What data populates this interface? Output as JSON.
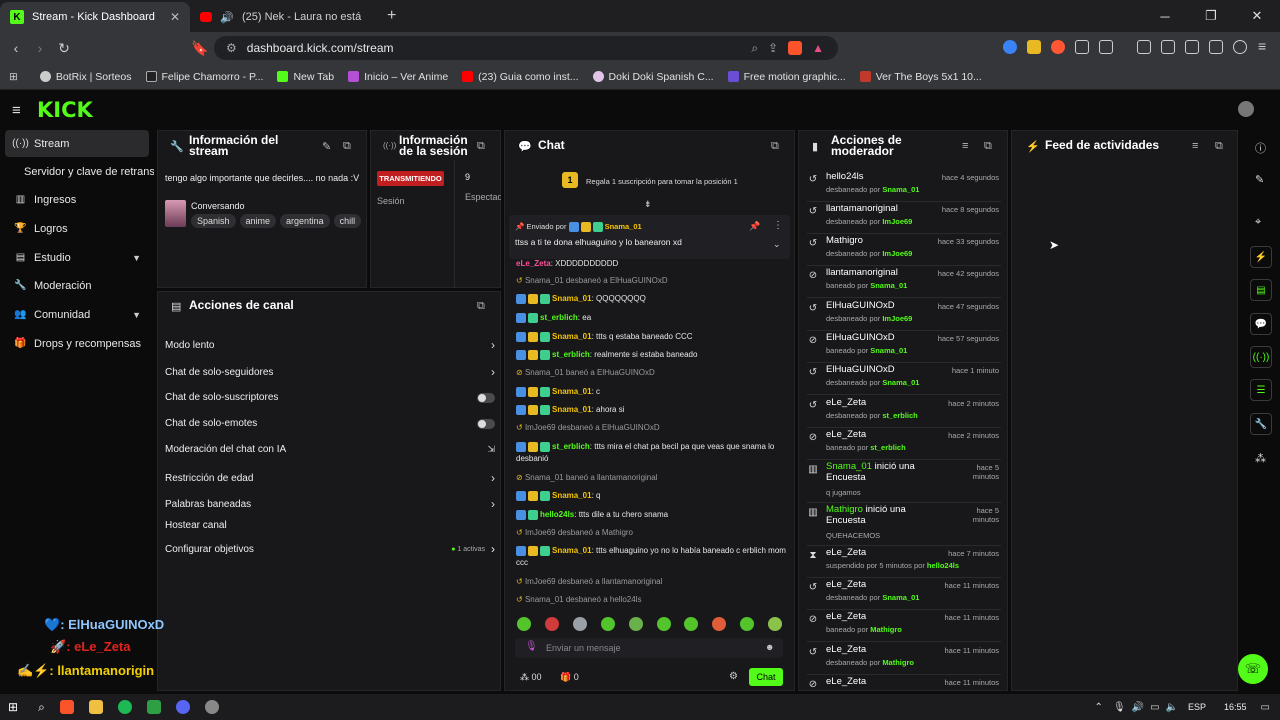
{
  "browser": {
    "tabs": [
      {
        "title": "Stream - Kick Dashboard",
        "active": true
      },
      {
        "title": "(25) Nek - Laura no está (Official ",
        "active": false
      }
    ],
    "url": "dashboard.kick.com/stream",
    "bookmarks": [
      "BotRix | Sorteos",
      "Felipe Chamorro - P...",
      "New Tab",
      "Inicio – Ver Anime",
      "(23) Guia como inst...",
      "Doki Doki Spanish C...",
      "Free motion graphic...",
      "Ver The Boys 5x1 10..."
    ]
  },
  "kick": {
    "logo": "KICK"
  },
  "sidebar": {
    "items": [
      {
        "label": "Stream",
        "icon": "broadcast-icon"
      },
      {
        "label": "Servidor y clave de retransm",
        "icon": ""
      },
      {
        "label": "Ingresos",
        "icon": "chart-icon"
      },
      {
        "label": "Logros",
        "icon": "trophy-icon"
      },
      {
        "label": "Estudio",
        "icon": "studio-icon"
      },
      {
        "label": "Moderación",
        "icon": "wrench-icon"
      },
      {
        "label": "Comunidad",
        "icon": "community-icon"
      },
      {
        "label": "Drops y recompensas",
        "icon": "gift-icon"
      }
    ]
  },
  "stream_info": {
    "title": "Información del stream",
    "description": "tengo algo importante que decirles.... no nada :V",
    "category": "Conversando",
    "tags": [
      "Spanish",
      "anime",
      "argentina",
      "chill"
    ]
  },
  "session_info": {
    "title": "Información de la sesión",
    "status": "TRANSMITIENDO",
    "status_label": "Sesión",
    "viewers": "9",
    "viewers_label": "Espectad"
  },
  "channel_actions": {
    "title": "Acciones de canal",
    "items": [
      {
        "label": "Modo lento",
        "control": "chevron"
      },
      {
        "label": "Chat de solo-seguidores",
        "control": "chevron"
      },
      {
        "label": "Chat de solo-suscriptores",
        "control": "toggle"
      },
      {
        "label": "Chat de solo-emotes",
        "control": "toggle"
      },
      {
        "label": "Moderación del chat con IA",
        "control": "external"
      },
      {
        "label": "Restricción de edad",
        "control": "chevron"
      },
      {
        "label": "Palabras baneadas",
        "control": "chevron"
      },
      {
        "label": "Hostear canal",
        "control": ""
      },
      {
        "label": "Configurar objetivos",
        "control": "chevron"
      }
    ],
    "goals_active": "1 activas"
  },
  "chat": {
    "title": "Chat",
    "gift_banner": "Regala 1 suscripción para tomar la posición 1",
    "gift_rank": "1",
    "pinned_label": "Enviado por",
    "pinned_user": "Snama_01",
    "pinned_message": "ttss a ti te dona elhuaguino y lo banearon xd",
    "messages": [
      {
        "type": "user",
        "user": "eLe_Zeta",
        "color": "up",
        "text": "XDDDDDDDDDD"
      },
      {
        "type": "sys",
        "text": "Snama_01 desbaneó a ElHuaGUINOxD"
      },
      {
        "type": "user",
        "user": "Snama_01",
        "color": "uy",
        "text": "QQQQQQQQ"
      },
      {
        "type": "user",
        "user": "st_erblich",
        "color": "ug",
        "text": "ea"
      },
      {
        "type": "user",
        "user": "Snama_01",
        "color": "uy",
        "text": "ttts q estaba baneado CCC"
      },
      {
        "type": "user",
        "user": "st_erblich",
        "color": "ug",
        "text": "realmente si estaba baneado"
      },
      {
        "type": "sys",
        "text": "Snama_01 baneó a ElHuaGUINOxD"
      },
      {
        "type": "user",
        "user": "Snama_01",
        "color": "uy",
        "text": "c"
      },
      {
        "type": "user",
        "user": "Snama_01",
        "color": "uy",
        "text": "ahora si"
      },
      {
        "type": "sys",
        "text": "ImJoe69 desbaneó a ElHuaGUINOxD"
      },
      {
        "type": "user",
        "user": "st_erblich",
        "color": "ug",
        "text": "ttts mira el chat pa becil pa que veas que snama lo desbanió"
      },
      {
        "type": "sys",
        "text": "Snama_01 baneó a llantamanoriginal"
      },
      {
        "type": "user",
        "user": "Snama_01",
        "color": "uy",
        "text": "q"
      },
      {
        "type": "user",
        "user": "hello24ls",
        "color": "ug",
        "text": "ttts dile a tu chero snama"
      },
      {
        "type": "sys",
        "text": "ImJoe69 desbaneó a Mathigro"
      },
      {
        "type": "user",
        "user": "Snama_01",
        "color": "uy",
        "text": "ttts elhuaguino yo no lo había baneado c erblich mom ccc"
      },
      {
        "type": "sys",
        "text": "ImJoe69 desbaneó a llantamanoriginal"
      },
      {
        "type": "sys",
        "text": "Snama_01 desbaneó a hello24ls"
      }
    ],
    "input_placeholder": "Enviar un mensaje",
    "points": "00",
    "subs": "0",
    "send_label": "Chat"
  },
  "mod_actions": {
    "title": "Acciones de moderador",
    "items": [
      {
        "user": "hello24ls",
        "action": "desbaneado por",
        "by": "Snama_01",
        "time": "hace 4 segundos",
        "icon": "unban-icon"
      },
      {
        "user": "llantamanoriginal",
        "action": "desbaneado por",
        "by": "ImJoe69",
        "time": "hace 8 segundos",
        "icon": "unban-icon"
      },
      {
        "user": "Mathigro",
        "action": "desbaneado por",
        "by": "ImJoe69",
        "time": "hace 33 segundos",
        "icon": "unban-icon"
      },
      {
        "user": "llantamanoriginal",
        "action": "baneado por",
        "by": "Snama_01",
        "time": "hace 42 segundos",
        "icon": "ban-icon"
      },
      {
        "user": "ElHuaGUINOxD",
        "action": "desbaneado por",
        "by": "ImJoe69",
        "time": "hace 47 segundos",
        "icon": "unban-icon"
      },
      {
        "user": "ElHuaGUINOxD",
        "action": "baneado por",
        "by": "Snama_01",
        "time": "hace 57 segundos",
        "icon": "ban-icon"
      },
      {
        "user": "ElHuaGUINOxD",
        "action": "desbaneado por",
        "by": "Snama_01",
        "time": "hace 1 minuto",
        "icon": "unban-icon"
      },
      {
        "user": "eLe_Zeta",
        "action": "desbaneado por",
        "by": "st_erblich",
        "time": "hace 2 minutos",
        "icon": "unban-icon"
      },
      {
        "user": "eLe_Zeta",
        "action": "baneado por",
        "by": "st_erblich",
        "time": "hace 2 minutos",
        "icon": "ban-icon"
      },
      {
        "user": "Snama_01",
        "action": "inició una Encuesta",
        "by": "q jugamos",
        "time": "hace 5 minutos",
        "icon": "poll-icon"
      },
      {
        "user": "Mathigro",
        "action": "inició una Encuesta",
        "by": "QUEHACEMOS",
        "time": "hace 5 minutos",
        "icon": "poll-icon"
      },
      {
        "user": "eLe_Zeta",
        "action": "suspendido por 5 minutos por",
        "by": "hello24ls",
        "time": "hace 7 minutos",
        "icon": "timeout-icon"
      },
      {
        "user": "eLe_Zeta",
        "action": "desbaneado por",
        "by": "Snama_01",
        "time": "hace 11 minutos",
        "icon": "unban-icon"
      },
      {
        "user": "eLe_Zeta",
        "action": "baneado por",
        "by": "Mathigro",
        "time": "hace 11 minutos",
        "icon": "ban-icon"
      },
      {
        "user": "eLe_Zeta",
        "action": "desbaneado por",
        "by": "Mathigro",
        "time": "hace 11 minutos",
        "icon": "unban-icon"
      },
      {
        "user": "eLe_Zeta",
        "action": "",
        "by": "",
        "time": "hace 11 minutos",
        "icon": "ban-icon"
      }
    ]
  },
  "activity_feed": {
    "title": "Feed de actividades"
  },
  "overlay": {
    "line1": ": ElHuaGUINOxD",
    "line2": ": eLe_Zeta",
    "line3": ": llantamanorigin"
  },
  "taskbar": {
    "lang": "ESP",
    "time": "16:55"
  },
  "colors": {
    "accent": "#53fc18",
    "live": "#d61f1f",
    "panel": "#18181b"
  }
}
